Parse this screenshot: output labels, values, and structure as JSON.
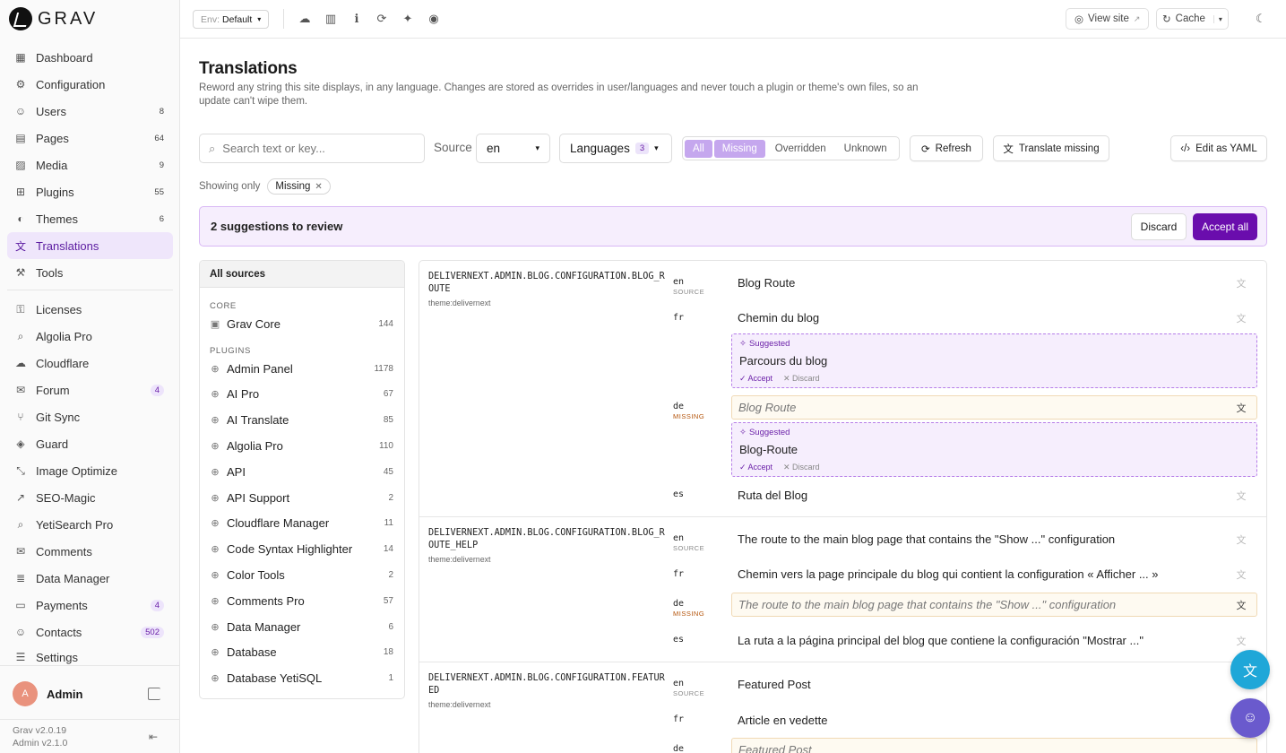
{
  "brand": {
    "name": "GRAV"
  },
  "sidebar": {
    "items": [
      {
        "label": "Dashboard",
        "icon": "dashboard-icon",
        "glyph": "▦",
        "count": ""
      },
      {
        "label": "Configuration",
        "icon": "gear-icon",
        "glyph": "⚙",
        "count": ""
      },
      {
        "label": "Users",
        "icon": "users-icon",
        "glyph": "☺",
        "count": "8"
      },
      {
        "label": "Pages",
        "icon": "pages-icon",
        "glyph": "▤",
        "count": "64"
      },
      {
        "label": "Media",
        "icon": "image-icon",
        "glyph": "▨",
        "count": "9"
      },
      {
        "label": "Plugins",
        "icon": "plugins-icon",
        "glyph": "⊞",
        "count": "55"
      },
      {
        "label": "Themes",
        "icon": "palette-icon",
        "glyph": "◐",
        "count": "6"
      },
      {
        "label": "Translations",
        "icon": "translate-icon",
        "glyph": "文",
        "count": ""
      },
      {
        "label": "Tools",
        "icon": "wrench-icon",
        "glyph": "⚒",
        "count": ""
      }
    ],
    "plugin_items": [
      {
        "label": "Licenses",
        "icon": "key-icon",
        "glyph": "⚿",
        "badge": ""
      },
      {
        "label": "Algolia Pro",
        "icon": "search-icon",
        "glyph": "⌕",
        "badge": ""
      },
      {
        "label": "Cloudflare",
        "icon": "cloud-icon",
        "glyph": "☁",
        "badge": ""
      },
      {
        "label": "Forum",
        "icon": "chat-icon",
        "glyph": "✉",
        "badge": "4"
      },
      {
        "label": "Git Sync",
        "icon": "git-icon",
        "glyph": "⑂",
        "badge": ""
      },
      {
        "label": "Guard",
        "icon": "shield-icon",
        "glyph": "◈",
        "badge": ""
      },
      {
        "label": "Image Optimize",
        "icon": "resize-icon",
        "glyph": "⤡",
        "badge": ""
      },
      {
        "label": "SEO-Magic",
        "icon": "chart-icon",
        "glyph": "↗",
        "badge": ""
      },
      {
        "label": "YetiSearch Pro",
        "icon": "search-icon",
        "glyph": "⌕",
        "badge": ""
      },
      {
        "label": "Comments",
        "icon": "comments-icon",
        "glyph": "✉",
        "badge": ""
      },
      {
        "label": "Data Manager",
        "icon": "database-icon",
        "glyph": "≣",
        "badge": ""
      },
      {
        "label": "Payments",
        "icon": "payments-icon",
        "glyph": "▭",
        "badge": "4"
      },
      {
        "label": "Contacts",
        "icon": "contacts-icon",
        "glyph": "☺",
        "badge": "502"
      }
    ],
    "settings": {
      "label": "Settings",
      "glyph": "☰"
    },
    "user": {
      "initial": "A",
      "name": "Admin"
    },
    "versions": {
      "grav": "Grav v2.0.19",
      "admin": "Admin v2.1.0"
    }
  },
  "topbar": {
    "env_key": "Env:",
    "env_value": "Default",
    "view_site": "View site",
    "cache": "Cache"
  },
  "page": {
    "title": "Translations",
    "description": "Reword any string this site displays, in any language. Changes are stored as overrides in user/languages and never touch a plugin or theme's own files, so an update can't wipe them."
  },
  "toolbar": {
    "search_placeholder": "Search text or key...",
    "source_label": "Source",
    "source_value": "en",
    "languages_label": "Languages",
    "languages_count": "3",
    "filters": [
      "All",
      "Missing",
      "Overridden",
      "Unknown"
    ],
    "refresh": "Refresh",
    "translate_missing": "Translate missing",
    "edit_yaml": "Edit as YAML",
    "showing_only": "Showing only",
    "chip": "Missing"
  },
  "banner": {
    "text": "2 suggestions to review",
    "discard": "Discard",
    "accept_all": "Accept all"
  },
  "sources": {
    "header": "All sources",
    "core_label": "CORE",
    "core": [
      {
        "name": "Grav Core",
        "count": "144"
      }
    ],
    "plugins_label": "PLUGINS",
    "plugins": [
      {
        "name": "Admin Panel",
        "count": "1178"
      },
      {
        "name": "AI Pro",
        "count": "67"
      },
      {
        "name": "AI Translate",
        "count": "85"
      },
      {
        "name": "Algolia Pro",
        "count": "110"
      },
      {
        "name": "API",
        "count": "45"
      },
      {
        "name": "API Support",
        "count": "2"
      },
      {
        "name": "Cloudflare Manager",
        "count": "11"
      },
      {
        "name": "Code Syntax Highlighter",
        "count": "14"
      },
      {
        "name": "Color Tools",
        "count": "2"
      },
      {
        "name": "Comments Pro",
        "count": "57"
      },
      {
        "name": "Data Manager",
        "count": "6"
      },
      {
        "name": "Database",
        "count": "18"
      },
      {
        "name": "Database YetiSQL",
        "count": "1"
      }
    ]
  },
  "keys": [
    {
      "key": "DELIVERNEXT.ADMIN.BLOG.CONFIGURATION.BLOG_ROUTE",
      "scope": "theme:delivernext",
      "en": "Blog Route",
      "fr": "Chemin du blog",
      "fr_suggestion": "Parcours du blog",
      "de_missing": "Blog Route",
      "de_suggestion": "Blog-Route",
      "es": "Ruta del Blog"
    },
    {
      "key": "DELIVERNEXT.ADMIN.BLOG.CONFIGURATION.BLOG_ROUTE_HELP",
      "scope": "theme:delivernext",
      "en": "The route to the main blog page that contains the \"Show ...\" configuration",
      "fr": "Chemin vers la page principale du blog qui contient la configuration « Afficher ... »",
      "de_missing": "The route to the main blog page that contains the \"Show ...\" configuration",
      "es": "La ruta a la página principal del blog que contiene la configuración \"Mostrar ...\""
    },
    {
      "key": "DELIVERNEXT.ADMIN.BLOG.CONFIGURATION.FEATURED",
      "scope": "theme:delivernext",
      "en": "Featured Post",
      "fr": "Article en vedette",
      "de_missing": "Featured Post"
    }
  ],
  "labels": {
    "source": "SOURCE",
    "missing": "MISSING",
    "suggested": "Suggested",
    "accept": "✓ Accept",
    "discard": "✕ Discard",
    "en": "en",
    "fr": "fr",
    "de": "de",
    "es": "es"
  },
  "colors": {
    "accent": "#6a0dad",
    "accent_soft": "#f6eefd",
    "fab_translate": "#1fa7d8",
    "fab_bot": "#6a5acd"
  }
}
